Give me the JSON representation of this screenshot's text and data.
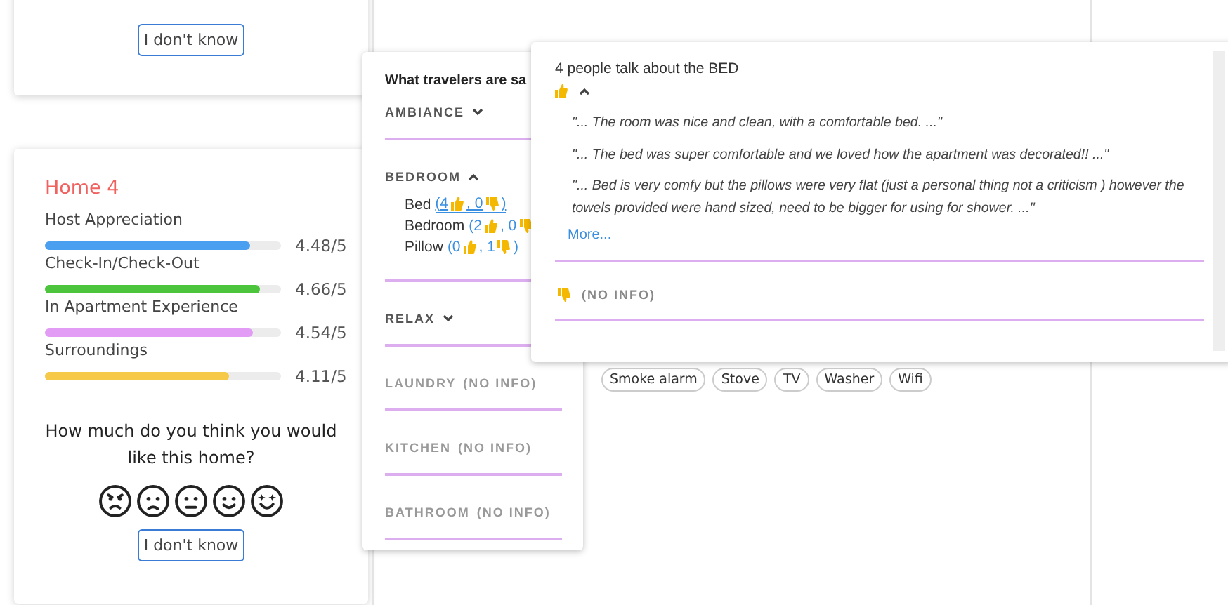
{
  "top_card": {
    "button": "I don't know"
  },
  "home": {
    "title": "Home 4",
    "metrics": [
      {
        "name": "Host Appreciation",
        "level": 0.87,
        "score": "4.48/5",
        "color": "#4a9ff0"
      },
      {
        "name": "Check-In/Check-Out",
        "level": 0.91,
        "score": "4.66/5",
        "color": "#4cc43c"
      },
      {
        "name": "In Apartment Experience",
        "level": 0.88,
        "score": "4.54/5",
        "color": "#e29cf5"
      },
      {
        "name": "Surroundings",
        "level": 0.78,
        "score": "4.11/5",
        "color": "#f7c948"
      }
    ],
    "question": "How much do you think you would like this home?",
    "button": "I don't know"
  },
  "amenities": [
    "Smoke alarm",
    "Stove",
    "TV",
    "Washer",
    "Wifi"
  ],
  "topics": {
    "header": "What travelers are sa",
    "sections": [
      {
        "name": "AMBIANCE",
        "expanded": false
      },
      {
        "name": "BEDROOM",
        "expanded": true,
        "items": [
          {
            "label": "Bed",
            "up": "(4",
            "down": ", 0",
            "end": ")",
            "selected": true
          },
          {
            "label": "Bedroom",
            "up": "(2",
            "down": ", 0",
            "selected": false
          },
          {
            "label": "Pillow",
            "up": "(0",
            "down": ", 1",
            "end": ")",
            "selected": false
          }
        ]
      },
      {
        "name": "RELAX",
        "expanded": false
      },
      {
        "name": "LAUNDRY",
        "note": "(NO INFO)"
      },
      {
        "name": "KITCHEN",
        "note": "(NO INFO)"
      },
      {
        "name": "BATHROOM",
        "note": "(NO INFO)"
      }
    ]
  },
  "detail": {
    "title": "4 people talk about the BED",
    "positive": {
      "expanded": true,
      "quotes": [
        "\"... The room was nice and clean, with a comfortable bed. ...\"",
        "\"... The bed was super comfortable and we loved how the apartment was decorated!! ...\"",
        "\"... Bed is very comfy but the pillows were very flat (just a personal thing not a criticism ) however the towels provided were hand sized, need to be bigger for using for shower. ...\""
      ],
      "more": "More..."
    },
    "negative": {
      "note": "(NO INFO)"
    }
  }
}
